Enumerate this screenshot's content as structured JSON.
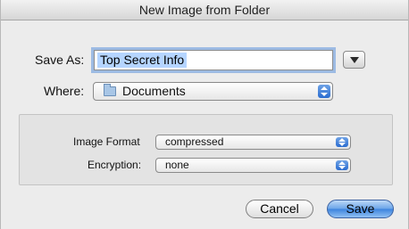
{
  "window": {
    "title": "New Image from Folder"
  },
  "save_as": {
    "label": "Save As:",
    "value": "Top Secret Info"
  },
  "where": {
    "label": "Where:",
    "value": "Documents",
    "icon": "folder-icon"
  },
  "options": {
    "image_format": {
      "label": "Image Format",
      "value": "compressed"
    },
    "encryption": {
      "label": "Encryption:",
      "value": "none"
    }
  },
  "buttons": {
    "cancel": "Cancel",
    "save": "Save"
  },
  "colors": {
    "focus_ring": "#9dbbe3",
    "selection": "#b5d5ff",
    "default_button": "#3c83de"
  }
}
